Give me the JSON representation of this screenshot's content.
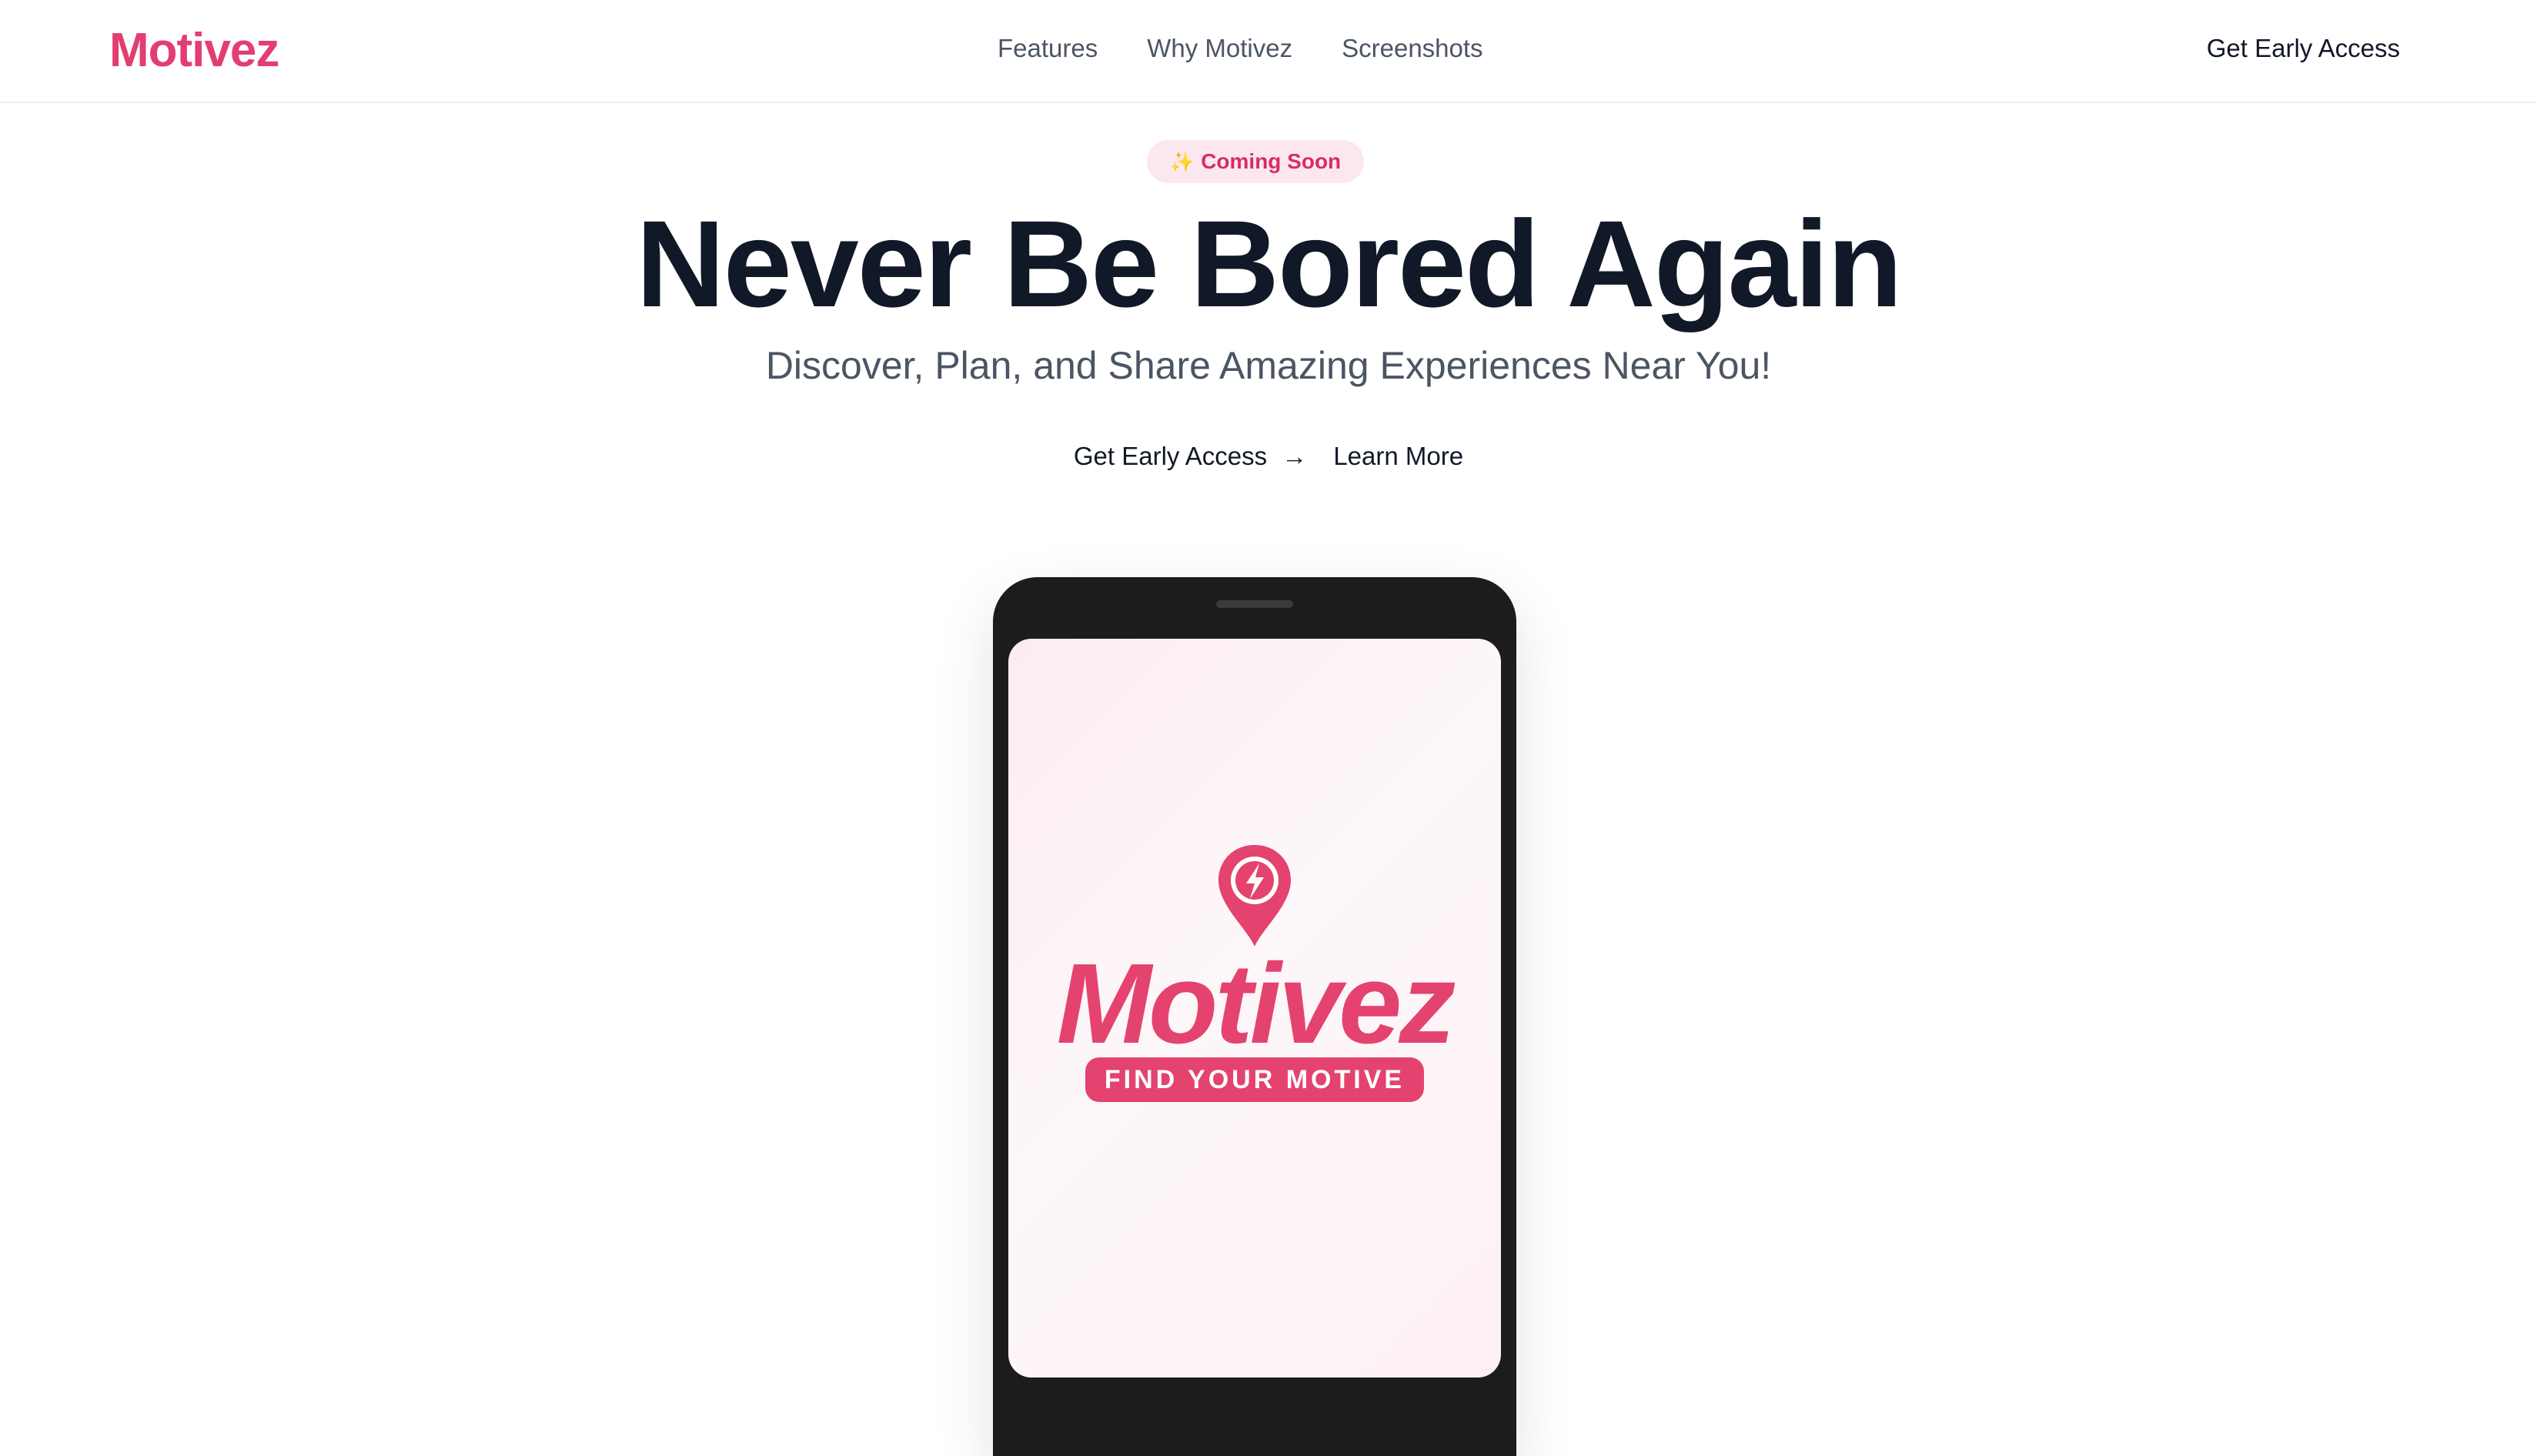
{
  "brand": {
    "name": "Motivez",
    "color": "#e23e72"
  },
  "nav": {
    "items": [
      {
        "label": "Features"
      },
      {
        "label": "Why Motivez"
      },
      {
        "label": "Screenshots"
      }
    ],
    "cta_label": "Get Early Access"
  },
  "hero": {
    "badge": {
      "icon": "sparkle-icon",
      "label": "Coming Soon"
    },
    "title": "Never Be Bored Again",
    "subtitle": "Discover, Plan, and Share Amazing Experiences Near You!",
    "primary_cta": "Get Early Access",
    "primary_cta_icon": "arrow-right-icon",
    "secondary_cta": "Learn More"
  },
  "phone": {
    "logo_icon": "location-pin-bolt-icon",
    "logo_word": "Motivez",
    "tagline": "FIND YOUR MOTIVE",
    "accent": "#e4436f"
  }
}
